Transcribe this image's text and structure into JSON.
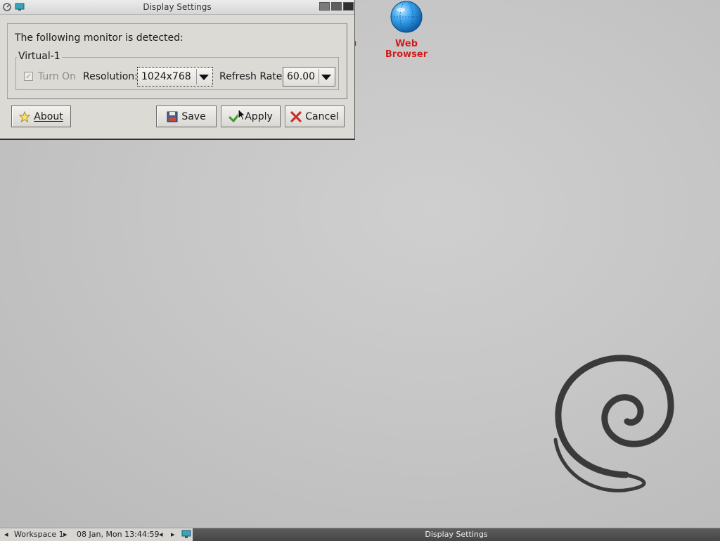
{
  "window": {
    "title": "Display Settings",
    "detected_text": "The following monitor is detected:",
    "monitor": {
      "name": "Virtual-1",
      "turn_on_label": "Turn On",
      "turn_on_checked": true,
      "resolution_label": "Resolution:",
      "resolution_value": "1024x768",
      "refresh_label": "Refresh Rate:",
      "refresh_value": "60.00"
    },
    "buttons": {
      "about": "About",
      "save": "Save",
      "apply": "Apply",
      "cancel": "Cancel"
    }
  },
  "desktop": {
    "icons": [
      {
        "label": "n",
        "icon": "truncated-app-icon"
      },
      {
        "label": "Web Browser",
        "icon": "globe-icon"
      }
    ]
  },
  "taskbar": {
    "workspace": "Workspace 1",
    "datetime": "08 Jan, Mon 13:44:59",
    "current_task": "Display Settings"
  },
  "colors": {
    "icon_label": "#d11a1a",
    "desktop_bg": "#c6c6c6",
    "taskbar_active": "#4f4f4f"
  }
}
